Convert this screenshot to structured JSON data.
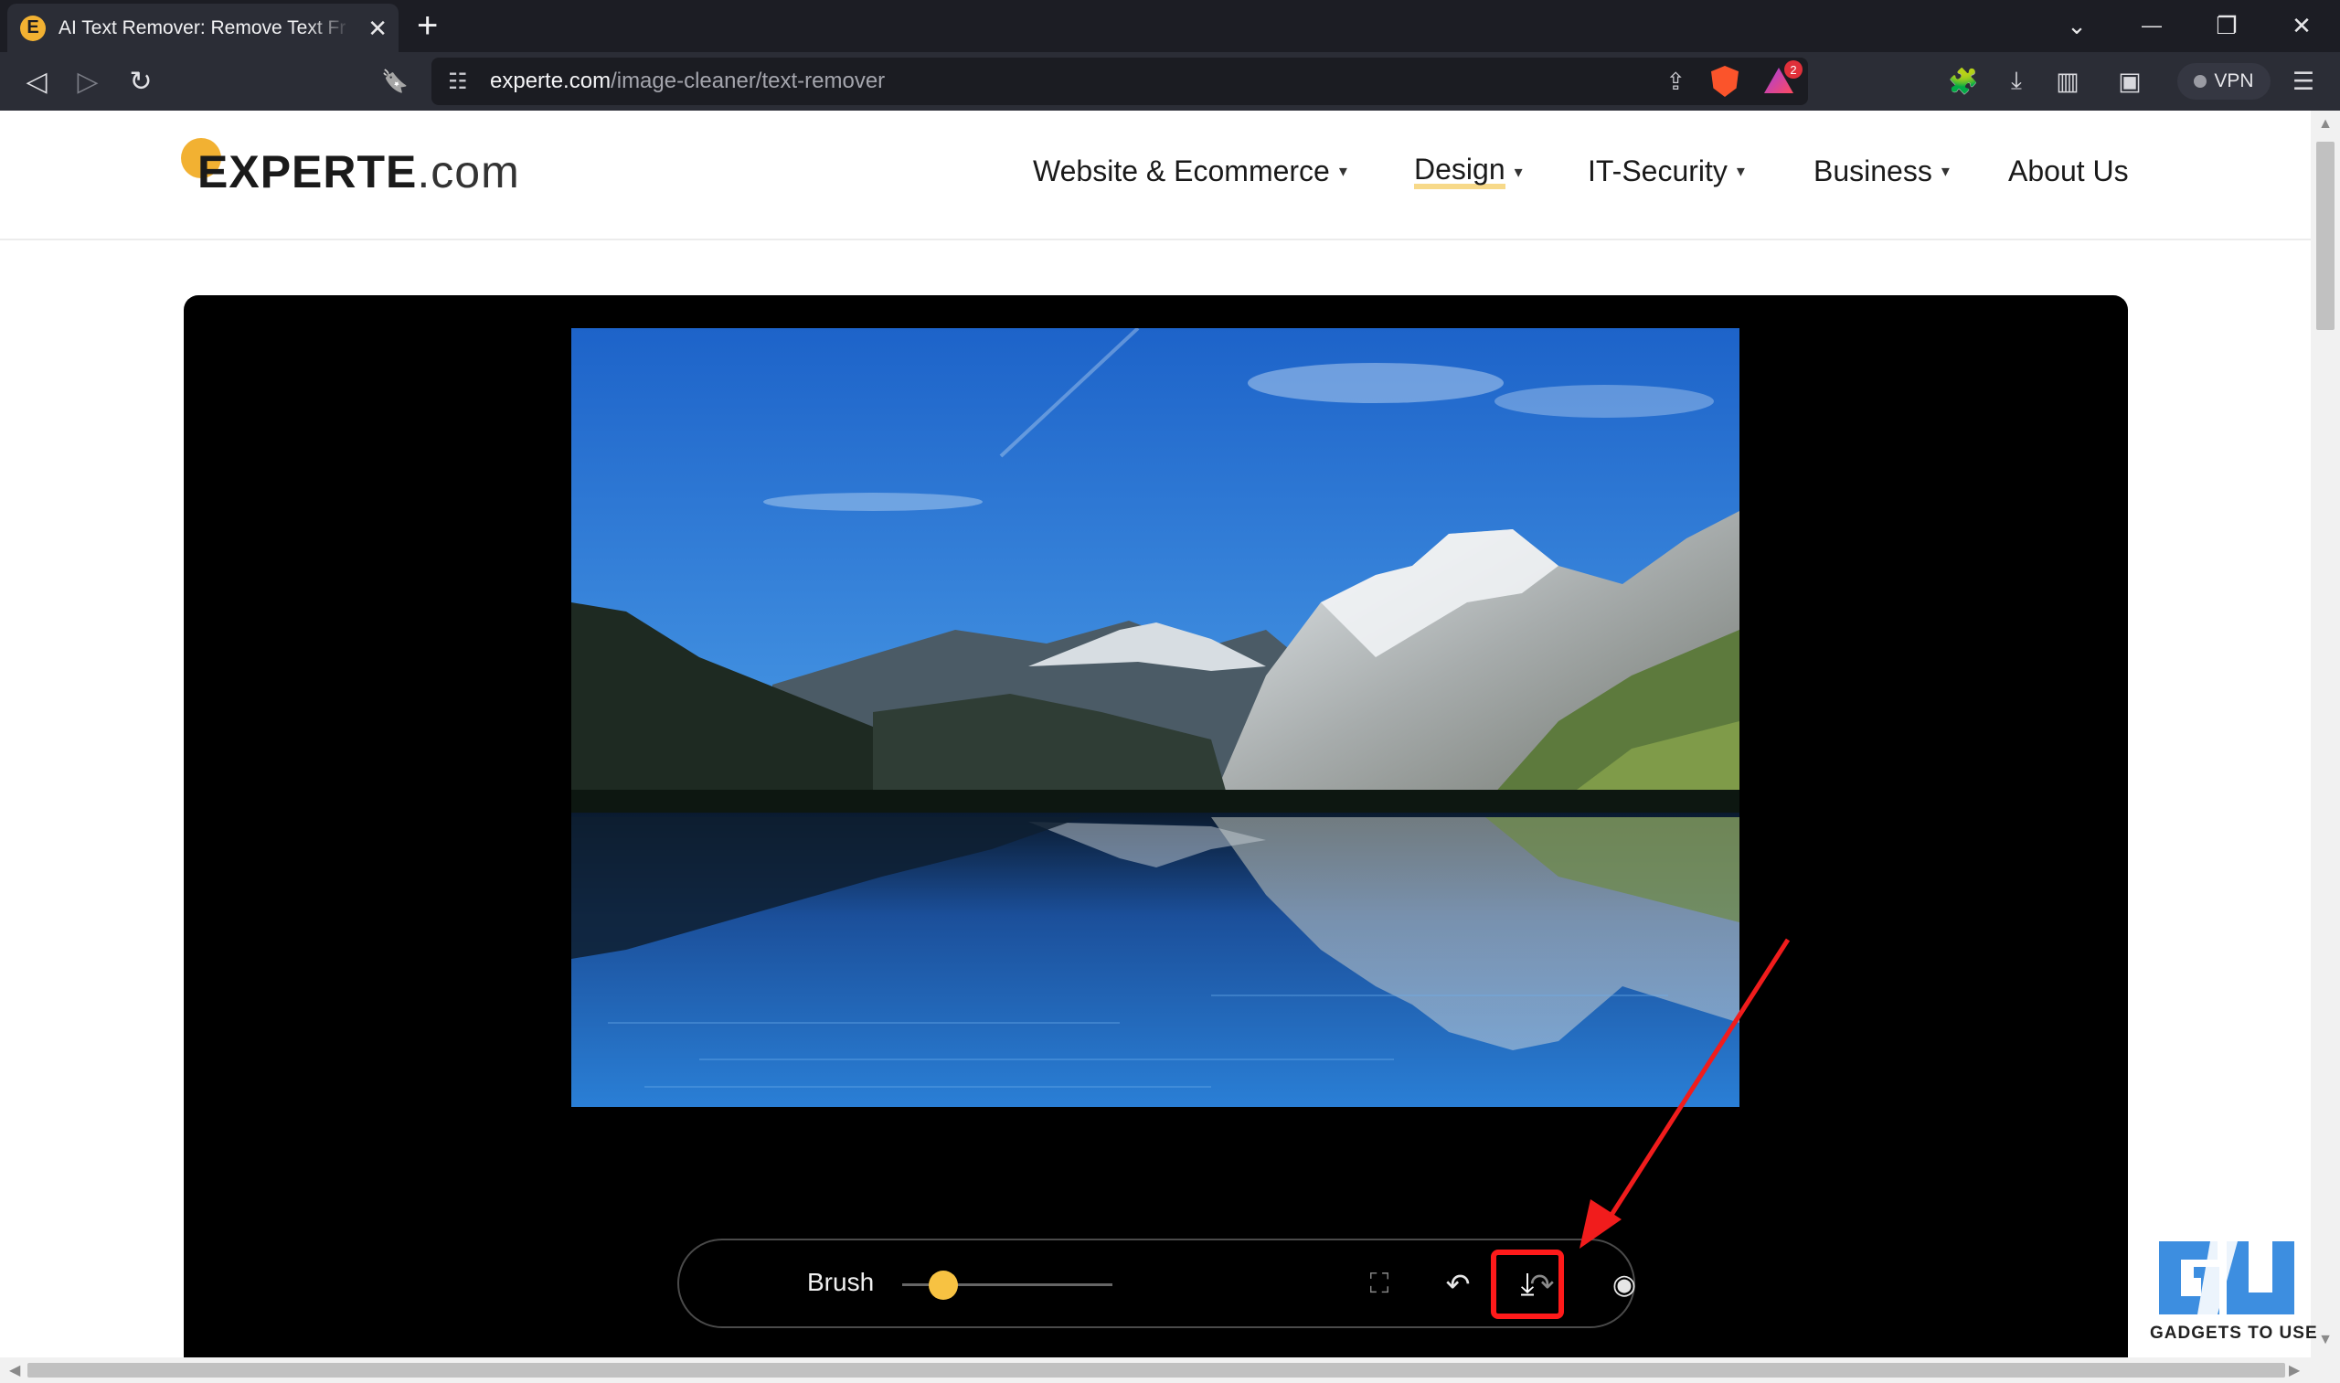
{
  "browser": {
    "tab": {
      "favicon_letter": "E",
      "title": "AI Text Remover: Remove Text Fr",
      "close_glyph": "✕"
    },
    "new_tab_glyph": "+",
    "window_controls": {
      "tab_search": "⌄",
      "minimize": "—",
      "restore": "❐",
      "close": "✕"
    },
    "nav": {
      "back": "◁",
      "forward": "▷",
      "reload": "↻",
      "bookmark": "🔖"
    },
    "address": {
      "host": "experte.com",
      "path": "/image-cleaner/text-remover",
      "site_info_glyph": "☷",
      "share_glyph": "⇪"
    },
    "rewards_badge": "2",
    "toolbar_icons": {
      "extensions": "🧩",
      "downloads": "⤓",
      "sidebar": "▥",
      "wallet": "▣",
      "menu": "☰"
    },
    "vpn_label": "VPN",
    "accent_color": "#f2b132"
  },
  "site": {
    "logo": {
      "main": "EXPERTE",
      "tld": ".com"
    },
    "nav": [
      {
        "label": "Website & Ecommerce",
        "has_dropdown": true
      },
      {
        "label": "Design",
        "has_dropdown": true,
        "active": true
      },
      {
        "label": "IT-Security",
        "has_dropdown": true
      },
      {
        "label": "Business",
        "has_dropdown": true
      },
      {
        "label": "About Us",
        "has_dropdown": false
      }
    ],
    "caret_glyph": "▾"
  },
  "editor": {
    "image_alt": "Mountain lake reflection",
    "brush_label": "Brush",
    "brush_size": 0.2,
    "icons": {
      "fullscreen": "⛶",
      "undo": "↶",
      "redo": "↷",
      "preview": "◉",
      "download": "⤓"
    },
    "highlight_color": "#ff1a1a"
  },
  "watermark": {
    "text": "GADGETS TO USE"
  }
}
